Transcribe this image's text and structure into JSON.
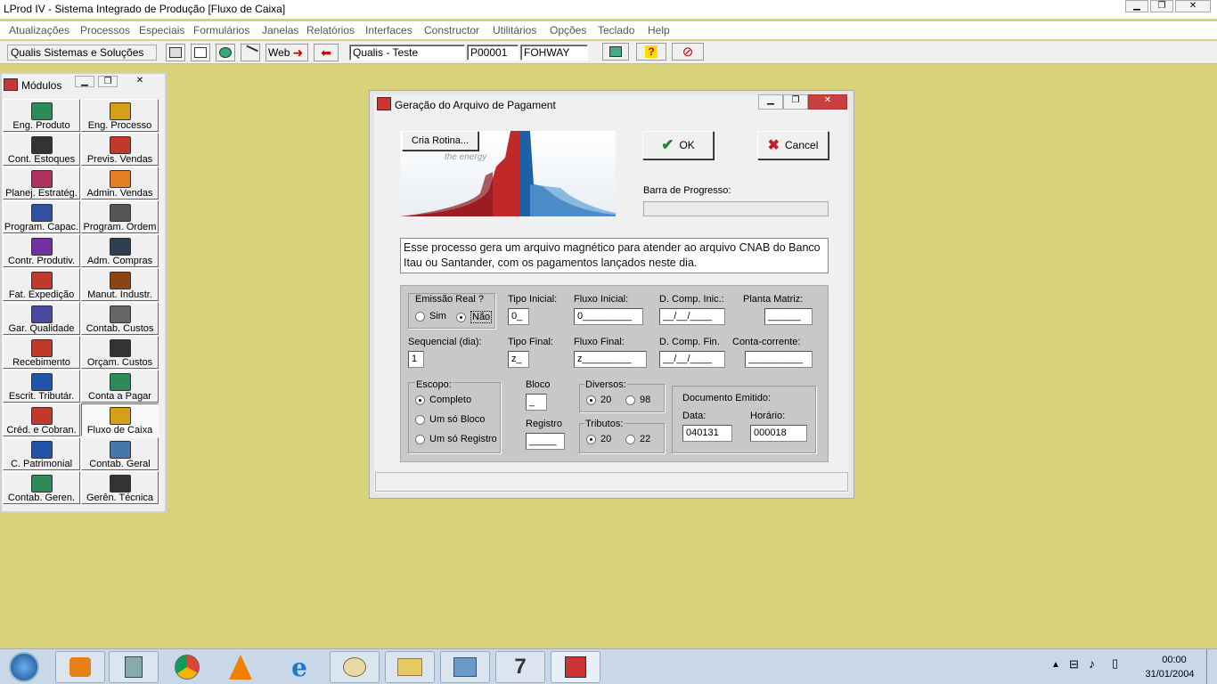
{
  "window": {
    "title": "LProd IV - Sistema Integrado de Produção [Fluxo de Caixa]"
  },
  "menu": [
    "Atualizações",
    "Processos",
    "Especiais",
    "Formulários",
    "Janelas",
    "Relatórios",
    "Interfaces",
    "Constructor",
    "Utilitários",
    "Opções",
    "Teclado",
    "Help"
  ],
  "toolbar": {
    "company": "Qualis Sistemas e Soluções",
    "web_label": "Web",
    "env": "Qualis - Teste",
    "code": "P00001",
    "user": "FOHWAY"
  },
  "modules": {
    "title": "Módulos",
    "items": [
      {
        "label": "Eng. Produto",
        "color": "#2e8b57"
      },
      {
        "label": "Eng. Processo",
        "color": "#d4a017"
      },
      {
        "label": "Cont. Estoques",
        "color": "#333333"
      },
      {
        "label": "Previs. Vendas",
        "color": "#c0392b"
      },
      {
        "label": "Planej. Estratég.",
        "color": "#b03060"
      },
      {
        "label": "Admin. Vendas",
        "color": "#e67e22"
      },
      {
        "label": "Program. Capac.",
        "color": "#3050a0"
      },
      {
        "label": "Program. Ordem",
        "color": "#555555"
      },
      {
        "label": "Contr. Produtiv.",
        "color": "#7030a0"
      },
      {
        "label": "Adm. Compras",
        "color": "#2c3e50"
      },
      {
        "label": "Fat. Expedição",
        "color": "#c0392b"
      },
      {
        "label": "Manut. Industr.",
        "color": "#8b4513"
      },
      {
        "label": "Gar. Qualidade",
        "color": "#4a4aa0"
      },
      {
        "label": "Contab. Custos",
        "color": "#666666"
      },
      {
        "label": "Recebimento",
        "color": "#c0392b"
      },
      {
        "label": "Orçam. Custos",
        "color": "#333333"
      },
      {
        "label": "Escrit. Tributár.",
        "color": "#2255aa"
      },
      {
        "label": "Conta a Pagar",
        "color": "#2e8b57"
      },
      {
        "label": "Créd. e Cobran.",
        "color": "#c0392b"
      },
      {
        "label": "Fluxo de Caixa",
        "color": "#d4a017"
      },
      {
        "label": "C. Patrimonial",
        "color": "#2255aa"
      },
      {
        "label": "Contab. Geral",
        "color": "#4477aa"
      },
      {
        "label": "Contab. Geren.",
        "color": "#2e8b57"
      },
      {
        "label": "Gerên. Técnica",
        "color": "#333333"
      }
    ]
  },
  "dialog": {
    "title": "Geração do Arquivo de Pagament",
    "cria_rotina": "Cria Rotina...",
    "banner_text": "the energy",
    "ok": "OK",
    "cancel": "Cancel",
    "progress_label": "Barra de Progresso:",
    "progress_value": 0,
    "description": "Esse processo gera um arquivo magnético para atender ao arquivo CNAB do Banco Itau ou Santander, com os pagamentos lançados neste dia.",
    "emissao_real": {
      "label": "Emissão Real ?",
      "sim": "Sim",
      "nao": "Não"
    },
    "tipo_inicial": {
      "label": "Tipo Inicial:",
      "value": "0_"
    },
    "fluxo_inicial": {
      "label": "Fluxo Inicial:",
      "value": "0_________"
    },
    "d_comp_inic": {
      "label": "D. Comp. Inic.:",
      "value": "__/__/____"
    },
    "planta_matriz": {
      "label": "Planta Matriz:",
      "value": "______"
    },
    "sequencial": {
      "label": "Sequencial (dia):",
      "value": "1"
    },
    "tipo_final": {
      "label": "Tipo Final:",
      "value": "z_"
    },
    "fluxo_final": {
      "label": "Fluxo Final:",
      "value": "z_________"
    },
    "d_comp_fin": {
      "label": "D. Comp. Fin.",
      "value": "__/__/____"
    },
    "conta_corrente": {
      "label": "Conta-corrente:",
      "value": "__________"
    },
    "escopo": {
      "label": "Escopo:",
      "options": [
        "Completo",
        "Um só Bloco",
        "Um só Registro"
      ]
    },
    "bloco": {
      "label": "Bloco",
      "value": "_"
    },
    "registro": {
      "label": "Registro",
      "value": "_____"
    },
    "diversos": {
      "label": "Diversos:",
      "options": [
        "20",
        "98"
      ]
    },
    "tributos": {
      "label": "Tributos:",
      "options": [
        "20",
        "22"
      ]
    },
    "documento": {
      "label": "Documento Emitido:",
      "data_label": "Data:",
      "data": "040131",
      "horario_label": "Horário:",
      "horario": "000018"
    }
  },
  "taskbar": {
    "time": "00:00",
    "date": "31/01/2004"
  }
}
